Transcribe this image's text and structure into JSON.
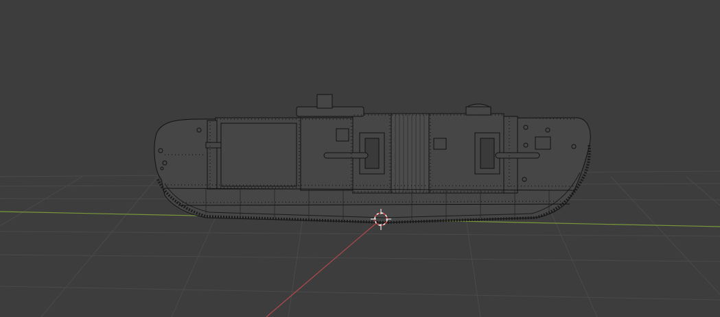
{
  "viewport": {
    "background": "#3d3d3d",
    "grid_color": "#4a4a4a",
    "x_axis_color": "#b34a4a",
    "y_axis_color": "#7a9a3a",
    "wire_color": "#111111",
    "mesh_fill": "#464646",
    "cursor_color": "#ffffff",
    "cursor_accent": "#d94040"
  },
  "scene": {
    "object": "tank-wireframe-mesh",
    "cursor": "3d-cursor-icon"
  }
}
